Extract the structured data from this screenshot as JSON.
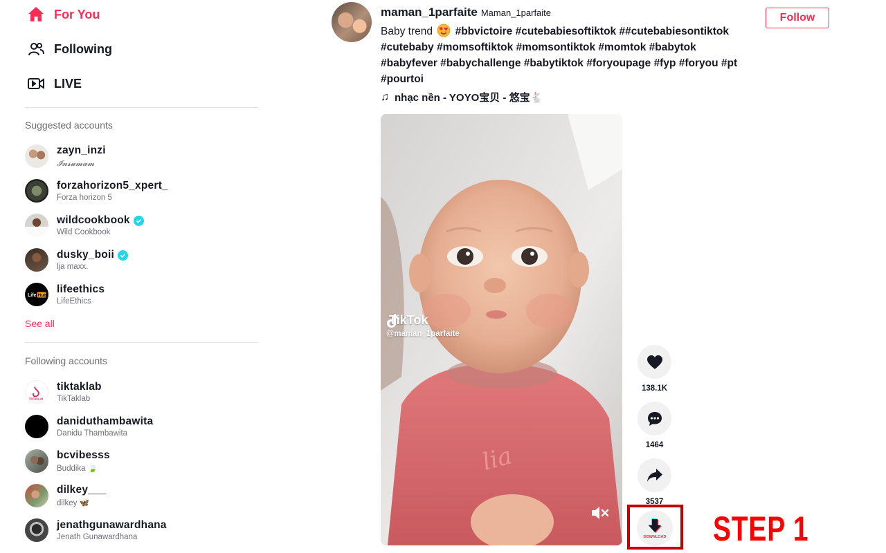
{
  "nav": {
    "for_you": "For You",
    "following": "Following",
    "live": "LIVE"
  },
  "suggested": {
    "title": "Suggested accounts",
    "accounts": [
      {
        "username": "zayn_inzi",
        "nickname": "𝓘𝓷𝓼𝓾𝓶𝓪𝓶",
        "verified": false
      },
      {
        "username": "forzahorizon5_xpert_",
        "nickname": "Forza horizon 5",
        "verified": false
      },
      {
        "username": "wildcookbook",
        "nickname": "Wild Cookbook",
        "verified": true
      },
      {
        "username": "dusky_boii",
        "nickname": "lja maxx.",
        "verified": true
      },
      {
        "username": "lifeethics",
        "nickname": "LifeEthics",
        "verified": false
      }
    ],
    "see_all": "See all"
  },
  "following_accounts": {
    "title": "Following accounts",
    "accounts": [
      {
        "username": "tiktaklab",
        "nickname": "TikTaklab"
      },
      {
        "username": "daniduthambawita",
        "nickname": "Danidu Thambawita"
      },
      {
        "username": "bcvibesss",
        "nickname": "Buddika 🍃"
      },
      {
        "username": "dilkey___",
        "nickname": "dilkey 🦋"
      },
      {
        "username": "jenathgunawardhana",
        "nickname": "Jenath Gunawardhana"
      }
    ]
  },
  "post": {
    "author": "maman_1parfaite",
    "author_nickname": "Maman_1parfaite",
    "follow_label": "Follow",
    "caption_prefix": "Baby trend",
    "hashtags": [
      "#bbvictoire",
      "#cutebabiesoftiktok",
      "##cutebabiesontiktok",
      "#cutebaby",
      "#momsoftiktok",
      "#momsontiktok",
      "#momtok",
      "#babytok",
      "#babyfever",
      "#babychallenge",
      "#babytiktok",
      "#foryoupage",
      "#fyp",
      "#foryou",
      "#pt",
      "#pourtoi"
    ],
    "music": "nhạc nền - YOYO宝贝 - 悠宝🐇",
    "watermark_brand": "TikTok",
    "watermark_user": "@maman_1parfaite"
  },
  "actions": {
    "likes": "138.1K",
    "comments": "1464",
    "shares": "3537",
    "download_label": "DOWNLOAD"
  },
  "annotation": {
    "step_label": "STEP 1",
    "highlight_color": "#c40000",
    "text_color": "#ff0000"
  },
  "colors": {
    "accent": "#fe2c55",
    "verified": "#20d5ec",
    "text": "#161823",
    "muted": "#6f7076"
  }
}
